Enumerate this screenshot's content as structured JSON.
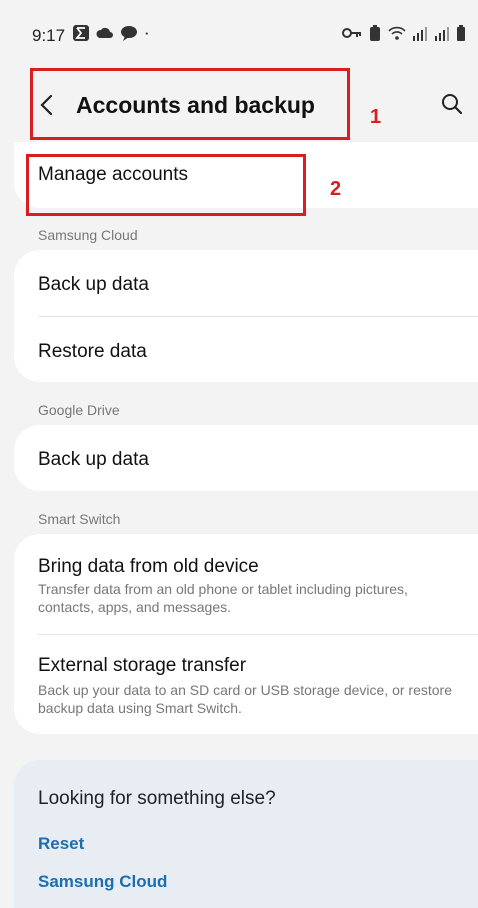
{
  "status_bar": {
    "time": "9:17",
    "left_icons": [
      "sigma-icon",
      "cloud-icon",
      "chat-bubble-icon",
      "dot-icon"
    ],
    "right_icons": [
      "key-icon",
      "battery-saver-icon",
      "wifi-icon",
      "signal-icon",
      "signal-icon",
      "battery-icon"
    ]
  },
  "header": {
    "title": "Accounts and backup",
    "back_icon": "chevron-left-icon",
    "search_icon": "search-icon"
  },
  "annotations": [
    {
      "label": "1",
      "color": "#d91e1e"
    },
    {
      "label": "2",
      "color": "#d91e1e"
    }
  ],
  "manage_accounts": {
    "label": "Manage accounts"
  },
  "samsung_cloud": {
    "section": "Samsung Cloud",
    "items": [
      {
        "label": "Back up data"
      },
      {
        "label": "Restore data"
      }
    ]
  },
  "google_drive": {
    "section": "Google Drive",
    "items": [
      {
        "label": "Back up data"
      }
    ]
  },
  "smart_switch": {
    "section": "Smart Switch",
    "items": [
      {
        "label": "Bring data from old device",
        "subtitle": "Transfer data from an old phone or tablet including pictures, contacts, apps, and messages."
      },
      {
        "label": "External storage transfer",
        "subtitle": "Back up your data to an SD card or USB storage device, or restore backup data using Smart Switch."
      }
    ]
  },
  "looking_for": {
    "question": "Looking for something else?",
    "links": [
      {
        "label": "Reset"
      },
      {
        "label": "Samsung Cloud"
      }
    ]
  },
  "colors": {
    "accent_link": "#1a6fb0",
    "annotation": "#d91e1e",
    "background": "#f3f3f3"
  }
}
